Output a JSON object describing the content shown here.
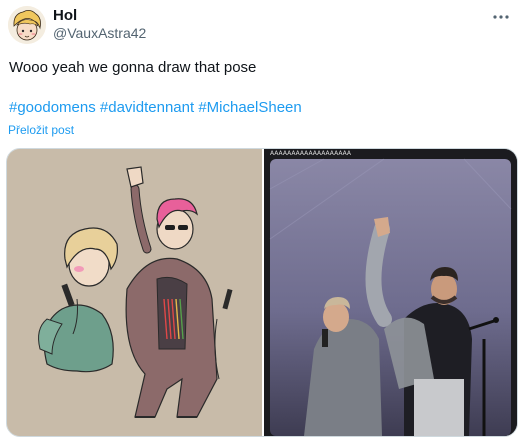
{
  "author": {
    "name": "Hol",
    "handle": "@VauxAstra42",
    "avatar_icon": "avatar-illustration"
  },
  "header": {
    "more_icon": "more-options-icon"
  },
  "tweet": {
    "text": "Wooo yeah we gonna draw that pose",
    "hashtags": [
      "#goodomens",
      "#davidtennant",
      "#MichaelSheen"
    ],
    "translate_label": "Přeložit post"
  },
  "media": {
    "left_image": "drawing-two-characters-pose",
    "right_image": "concert-photo-two-men-pose",
    "right_caption": "AAAAAAAAAAAAAAAAAAA"
  },
  "colors": {
    "link": "#1d9bf0",
    "secondary_text": "#536471",
    "primary_text": "#0f1419",
    "drawing_bg": "#c8bba9",
    "photo_bg": "#1b1b1f"
  }
}
